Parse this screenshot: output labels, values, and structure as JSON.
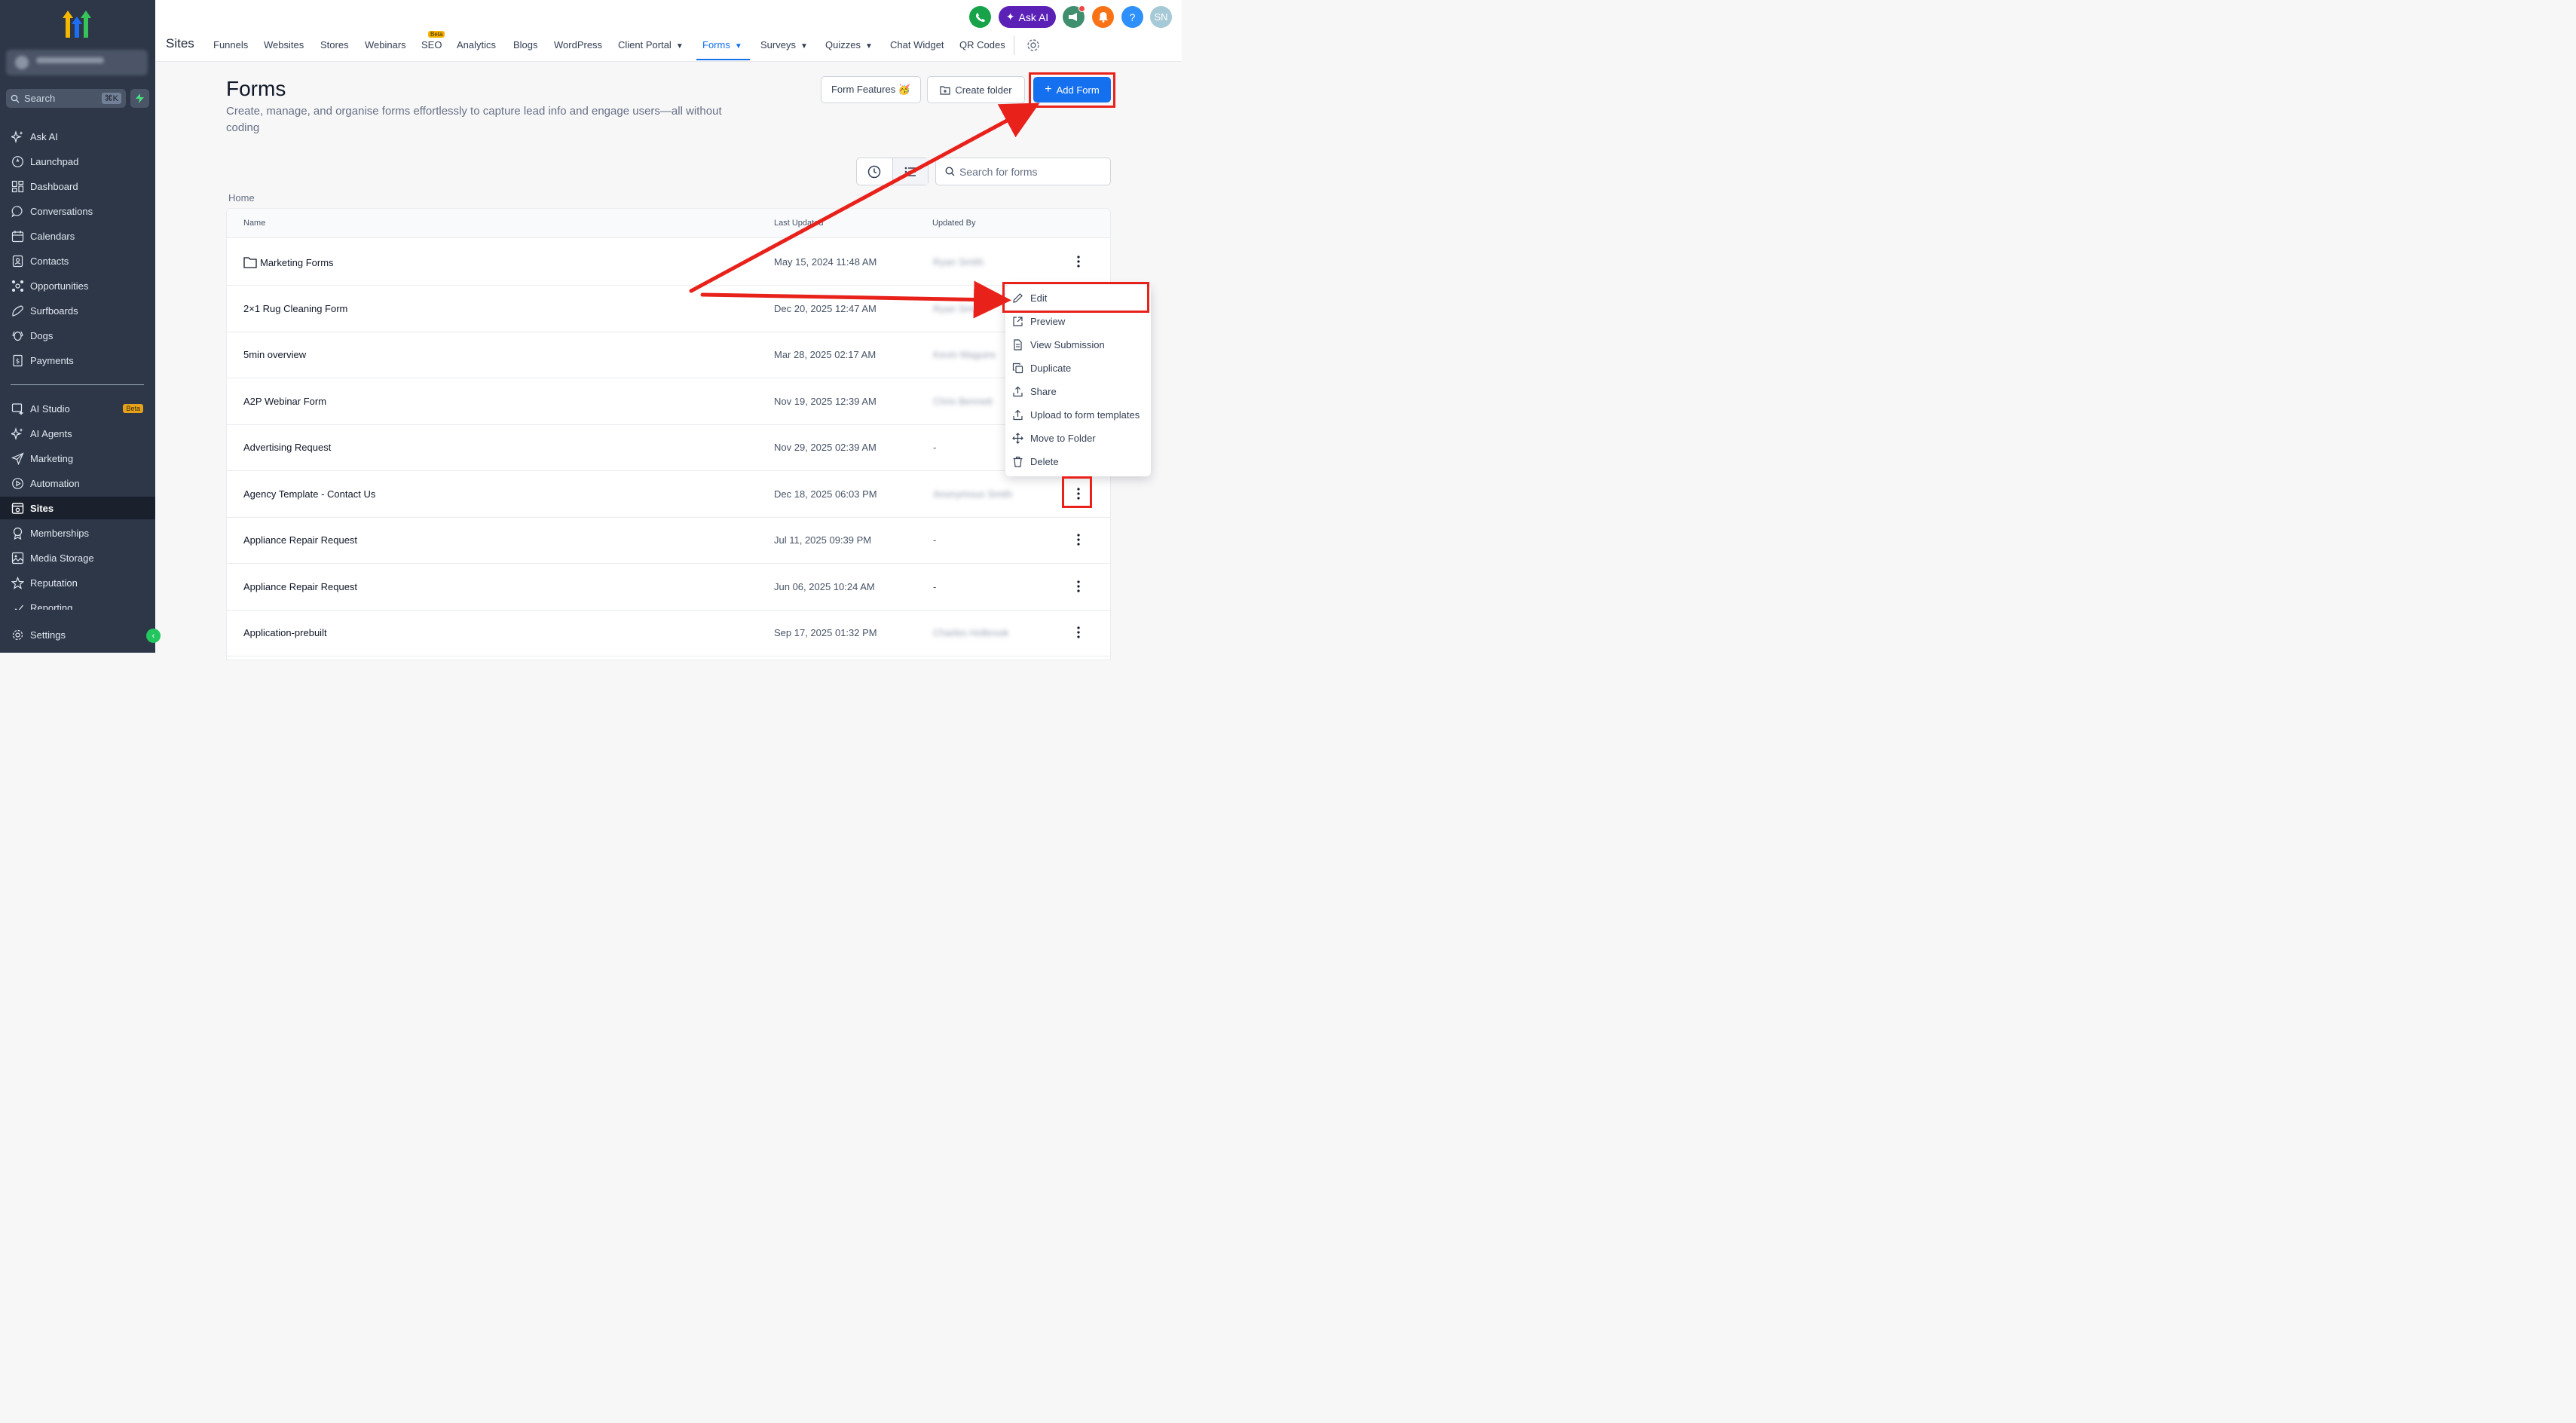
{
  "sidebar": {
    "search": {
      "placeholder": "Search",
      "shortcut": "⌘K"
    },
    "items": [
      {
        "label": "Ask AI",
        "icon": "sparkle-icon"
      },
      {
        "label": "Launchpad",
        "icon": "rocket-icon"
      },
      {
        "label": "Dashboard",
        "icon": "grid-icon"
      },
      {
        "label": "Conversations",
        "icon": "chat-icon"
      },
      {
        "label": "Calendars",
        "icon": "calendar-icon"
      },
      {
        "label": "Contacts",
        "icon": "contacts-icon"
      },
      {
        "label": "Opportunities",
        "icon": "opportunities-icon"
      },
      {
        "label": "Surfboards",
        "icon": "surfboard-icon"
      },
      {
        "label": "Dogs",
        "icon": "dog-icon"
      },
      {
        "label": "Payments",
        "icon": "payments-icon"
      },
      {
        "label": "AI Studio",
        "icon": "ai-studio-icon",
        "badge": "Beta"
      },
      {
        "label": "AI Agents",
        "icon": "sparkle-icon"
      },
      {
        "label": "Marketing",
        "icon": "send-icon"
      },
      {
        "label": "Automation",
        "icon": "automation-icon"
      },
      {
        "label": "Sites",
        "icon": "sites-icon",
        "active": true
      },
      {
        "label": "Memberships",
        "icon": "badge-icon"
      },
      {
        "label": "Media Storage",
        "icon": "image-icon"
      },
      {
        "label": "Reputation",
        "icon": "star-icon"
      },
      {
        "label": "Reporting",
        "icon": "chart-icon"
      },
      {
        "label": "Settings",
        "icon": "gear-icon"
      }
    ]
  },
  "topnav": {
    "title": "Sites",
    "tabs": [
      {
        "label": "Funnels"
      },
      {
        "label": "Websites"
      },
      {
        "label": "Stores"
      },
      {
        "label": "Webinars"
      },
      {
        "label": "SEO",
        "badge": "Beta"
      },
      {
        "label": "Analytics"
      },
      {
        "label": "Blogs"
      },
      {
        "label": "WordPress"
      },
      {
        "label": "Client Portal",
        "dropdown": true
      },
      {
        "label": "Forms",
        "dropdown": true,
        "active": true
      },
      {
        "label": "Surveys",
        "dropdown": true
      },
      {
        "label": "Quizzes",
        "dropdown": true
      },
      {
        "label": "Chat Widget"
      },
      {
        "label": "QR Codes"
      }
    ],
    "ask_ai": "Ask AI",
    "avatar": "SN"
  },
  "page": {
    "title": "Forms",
    "subtitle": "Create, manage, and organise forms effortlessly to capture lead info and engage users—all without coding",
    "form_features": "Form Features 🥳",
    "create_folder": "Create folder",
    "add_form": "Add Form",
    "search_placeholder": "Search for forms",
    "breadcrumb": "Home"
  },
  "table": {
    "columns": [
      "Name",
      "Last Updated",
      "Updated By"
    ],
    "rows": [
      {
        "name": "Marketing Forms",
        "folder": true,
        "updated": "May 15, 2024 11:48 AM",
        "by": "Ryan Smith",
        "by_blurred": true
      },
      {
        "name": "2×1 Rug Cleaning Form",
        "updated": "Dec 20, 2025 12:47 AM",
        "by": "Ryan Smith",
        "by_blurred": true
      },
      {
        "name": "5min overview",
        "updated": "Mar 28, 2025 02:17 AM",
        "by": "Kevin Maguire",
        "by_blurred": true
      },
      {
        "name": "A2P Webinar Form",
        "updated": "Nov 19, 2025 12:39 AM",
        "by": "Chris Bennett",
        "by_blurred": true
      },
      {
        "name": "Advertising Request",
        "updated": "Nov 29, 2025 02:39 AM",
        "by": "-"
      },
      {
        "name": "Agency Template - Contact Us",
        "updated": "Dec 18, 2025 06:03 PM",
        "by": "Anonymous Smith",
        "by_blurred": true
      },
      {
        "name": "Appliance Repair Request",
        "updated": "Jul 11, 2025 09:39 PM",
        "by": "-"
      },
      {
        "name": "Appliance Repair Request",
        "updated": "Jun 06, 2025 10:24 AM",
        "by": "-"
      },
      {
        "name": "Application-prebuilt",
        "updated": "Sep 17, 2025 01:32 PM",
        "by": "Charles Holbrook",
        "by_blurred": true
      }
    ]
  },
  "menu": {
    "items": [
      {
        "label": "Edit",
        "icon": "pencil-icon"
      },
      {
        "label": "Preview",
        "icon": "external-link-icon"
      },
      {
        "label": "View Submission",
        "icon": "document-icon"
      },
      {
        "label": "Duplicate",
        "icon": "copy-icon"
      },
      {
        "label": "Share",
        "icon": "share-icon"
      },
      {
        "label": "Upload to form templates",
        "icon": "upload-icon"
      },
      {
        "label": "Move to Folder",
        "icon": "move-icon"
      },
      {
        "label": "Delete",
        "icon": "trash-icon"
      }
    ]
  },
  "colors": {
    "accent": "#1570ef",
    "sidebar": "#2d3748",
    "annotation": "#e8211b"
  }
}
